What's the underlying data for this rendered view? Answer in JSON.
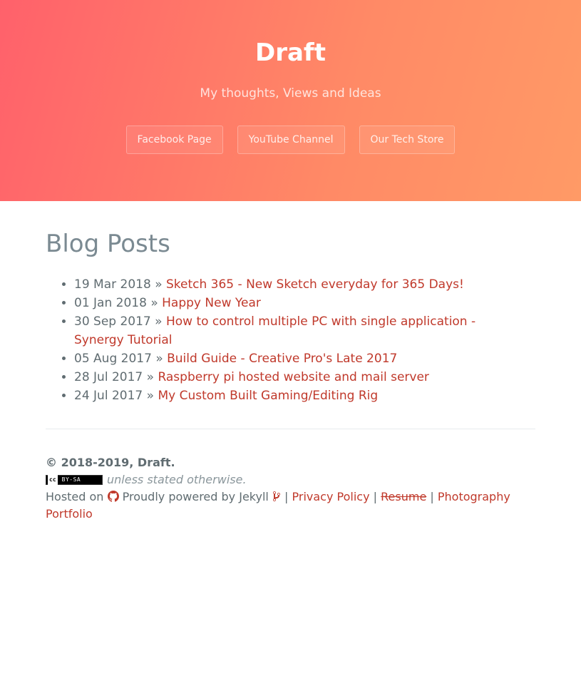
{
  "header": {
    "title": "Draft",
    "tagline": "My thoughts, Views and Ideas",
    "buttons": [
      "Facebook Page",
      "YouTube Channel",
      "Our Tech Store"
    ]
  },
  "main": {
    "heading": "Blog Posts",
    "posts": [
      {
        "date": "19 Mar 2018",
        "title": "Sketch 365 - New Sketch everyday for 365 Days!"
      },
      {
        "date": "01 Jan 2018",
        "title": "Happy New Year"
      },
      {
        "date": "30 Sep 2017",
        "title": "How to control multiple PC with single application - Synergy Tutorial"
      },
      {
        "date": "05 Aug 2017",
        "title": "Build Guide - Creative Pro's Late 2017"
      },
      {
        "date": "28 Jul 2017",
        "title": "Raspberry pi hosted website and mail server"
      },
      {
        "date": "24 Jul 2017",
        "title": "My Custom Built Gaming/Editing Rig"
      }
    ],
    "separator": "»"
  },
  "footer": {
    "copyright": "© 2018-2019, Draft.",
    "license_badge": "BY-SA",
    "license_note": "unless stated otherwise.",
    "hosted_on": "Hosted on",
    "powered_by": "Proudly powered by Jekyll",
    "pipe": "|",
    "links": {
      "privacy": "Privacy Policy",
      "resume": "Resume",
      "photography": "Photography Portfolio"
    },
    "icons": [
      "github-icon",
      "git-branch-icon"
    ]
  },
  "colors": {
    "gradient_start": "#ff616b",
    "gradient_end": "#ff9a66",
    "link": "#c0392b"
  }
}
